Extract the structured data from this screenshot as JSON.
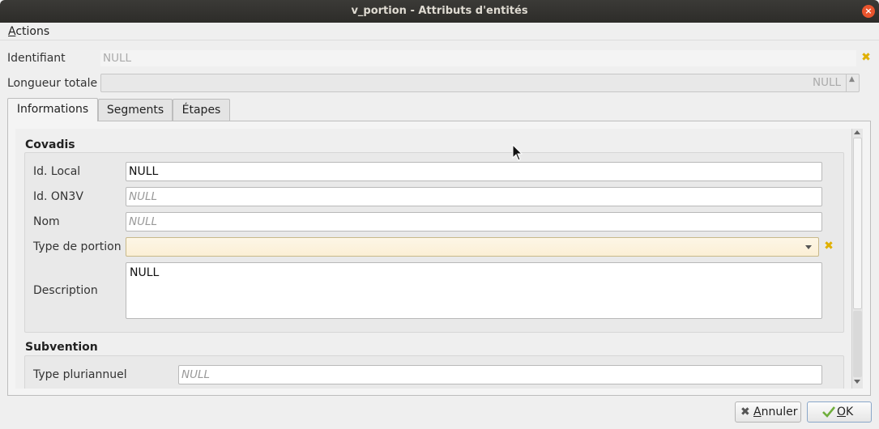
{
  "window": {
    "title": "v_portion - Attributs d'entités",
    "close_glyph": "×"
  },
  "menubar": {
    "actions_first": "A",
    "actions_rest": "ctions"
  },
  "fields": {
    "identifiant": {
      "label": "Identifiant",
      "value": "NULL"
    },
    "longueur_totale": {
      "label": "Longueur totale",
      "value": "NULL"
    }
  },
  "tabs": [
    {
      "label": "Informations",
      "active": true
    },
    {
      "label": "Segments",
      "active": false
    },
    {
      "label": "Étapes",
      "active": false
    }
  ],
  "groups": {
    "covadis": {
      "title": "Covadis",
      "id_local": {
        "label": "Id. Local",
        "value": "NULL"
      },
      "id_on3v": {
        "label": "Id. ON3V",
        "placeholder": "NULL"
      },
      "nom": {
        "label": "Nom",
        "placeholder": "NULL"
      },
      "type_portion": {
        "label": "Type de portion",
        "value": ""
      },
      "description": {
        "label": "Description",
        "value": "NULL"
      }
    },
    "subvention": {
      "title": "Subvention",
      "type_pluriannuel": {
        "label": "Type pluriannuel",
        "placeholder": "NULL"
      }
    }
  },
  "buttons": {
    "cancel": {
      "icon": "cancel-x-icon",
      "mnemonic": "A",
      "rest": "nnuler"
    },
    "ok": {
      "icon": "checkmark-icon",
      "mnemonic": "O",
      "rest": "K"
    }
  },
  "icons": {
    "clear": "✖",
    "spin_up": "▲"
  },
  "colors": {
    "clear_icon": "#e0b000",
    "titlebar": "#2d2c29",
    "close_button": "#e9542d",
    "ok_check": "#4caf50"
  }
}
